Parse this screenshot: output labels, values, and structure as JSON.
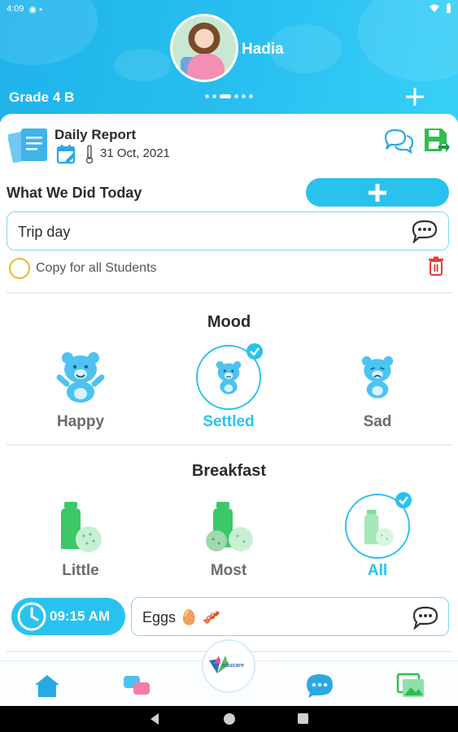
{
  "status_bar": {
    "time": "4:09"
  },
  "header": {
    "student_name": "Hadia",
    "grade": "Grade 4 B",
    "pager_dots": 6,
    "pager_active": 3
  },
  "report": {
    "title": "Daily Report",
    "date": "31 Oct, 2021"
  },
  "activities": {
    "title": "What We Did Today",
    "value": "Trip day"
  },
  "copy_option": {
    "label": "Copy for all Students",
    "checked": false
  },
  "mood": {
    "title": "Mood",
    "selected": "Settled",
    "options": [
      {
        "label": "Happy"
      },
      {
        "label": "Settled"
      },
      {
        "label": "Sad"
      }
    ]
  },
  "breakfast": {
    "title": "Breakfast",
    "selected": "All",
    "options": [
      {
        "label": "Little"
      },
      {
        "label": "Most"
      },
      {
        "label": "All"
      }
    ],
    "time": "09:15 AM",
    "note": "Eggs 🥚 🥓"
  },
  "bottom_nav": {
    "logo_text": "educare"
  },
  "colors": {
    "accent": "#29c2ef",
    "green": "#2dbf4f",
    "warning": "#f0b732",
    "danger": "#e53935"
  }
}
